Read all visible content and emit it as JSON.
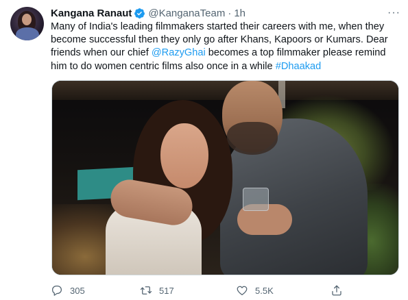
{
  "tweet": {
    "author_name": "Kangana Ranaut",
    "handle": "@KanganaTeam",
    "separator": "·",
    "time": "1h",
    "more_label": "···",
    "text_lines": [
      {
        "before": "Many of India's leading filmmakers started their careers with me, when they",
        "link": "",
        "after": ""
      },
      {
        "before": "become successful then they only go after Khans, Kapoors or Kumars. Dear",
        "link": "",
        "after": ""
      },
      {
        "before": "friends when our chief ",
        "link": "@RazyGhai",
        "after": " becomes a top filmmaker please remind"
      },
      {
        "before": "him to do women centric films also once in a while ",
        "link": "#Dhaakad",
        "after": ""
      }
    ],
    "actions": {
      "reply": {
        "icon": "reply-icon",
        "count": "305"
      },
      "retweet": {
        "icon": "retweet-icon",
        "count": "517"
      },
      "like": {
        "icon": "heart-icon",
        "count": "5.5K"
      },
      "share": {
        "icon": "share-icon",
        "count": ""
      }
    }
  },
  "colors": {
    "link": "#1d9bf0",
    "secondary_text": "#536471",
    "primary_text": "#0f1419",
    "verified": "#1d9bf0"
  }
}
